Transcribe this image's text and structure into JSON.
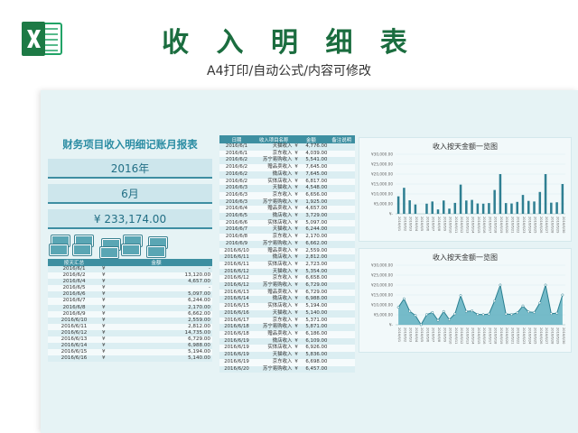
{
  "header": {
    "title": "收 入 明 细 表",
    "subtitle": "A4打印/自动公式/内容可修改"
  },
  "colors": {
    "accent": "#3d8fa1",
    "title_green": "#1b6d3f",
    "sheet_bg": "#e6f3f5"
  },
  "icons": {
    "logo": "excel-logo-icon",
    "money": "money-stack-icon"
  },
  "summary": {
    "title": "财务项目收入明细记账月报表",
    "year": "2016年",
    "month": "6月",
    "total": "¥ 233,174.00"
  },
  "daily_table": {
    "headers": [
      "按天汇总",
      "金额"
    ],
    "rows": [
      {
        "date": "2016/6/1",
        "currency": "¥",
        "amount": "-"
      },
      {
        "date": "2016/6/2",
        "currency": "¥",
        "amount": "13,120.00"
      },
      {
        "date": "2016/6/4",
        "currency": "¥",
        "amount": "4,657.00"
      },
      {
        "date": "2016/6/5",
        "currency": "¥",
        "amount": "-"
      },
      {
        "date": "2016/6/6",
        "currency": "¥",
        "amount": "5,097.00"
      },
      {
        "date": "2016/6/7",
        "currency": "¥",
        "amount": "6,244.00"
      },
      {
        "date": "2016/6/8",
        "currency": "¥",
        "amount": "2,170.00"
      },
      {
        "date": "2016/6/9",
        "currency": "¥",
        "amount": "6,662.00"
      },
      {
        "date": "2016/6/10",
        "currency": "¥",
        "amount": "2,559.00"
      },
      {
        "date": "2016/6/11",
        "currency": "¥",
        "amount": "2,812.00"
      },
      {
        "date": "2016/6/12",
        "currency": "¥",
        "amount": "14,735.00"
      },
      {
        "date": "2016/6/13",
        "currency": "¥",
        "amount": "6,729.00"
      },
      {
        "date": "2016/6/14",
        "currency": "¥",
        "amount": "6,988.00"
      },
      {
        "date": "2016/6/15",
        "currency": "¥",
        "amount": "5,194.00"
      },
      {
        "date": "2016/6/16",
        "currency": "¥",
        "amount": "5,140.00"
      }
    ]
  },
  "detail_table": {
    "headers": [
      "日期",
      "收入项目名称",
      "金额",
      "备注说明"
    ],
    "rows": [
      {
        "date": "2016/6/1",
        "type": "天猫收入",
        "currency": "¥",
        "amount": "4,776.00"
      },
      {
        "date": "2016/6/1",
        "type": "京东收入",
        "currency": "¥",
        "amount": "4,039.00"
      },
      {
        "date": "2016/6/2",
        "type": "苏宁易购收入",
        "currency": "¥",
        "amount": "5,541.00"
      },
      {
        "date": "2016/6/2",
        "type": "赠品卖收入",
        "currency": "¥",
        "amount": "7,645.00"
      },
      {
        "date": "2016/6/2",
        "type": "微店收入",
        "currency": "¥",
        "amount": "7,645.00"
      },
      {
        "date": "2016/6/2",
        "type": "实体店收入",
        "currency": "¥",
        "amount": "6,817.00"
      },
      {
        "date": "2016/6/3",
        "type": "天猫收入",
        "currency": "¥",
        "amount": "4,548.00"
      },
      {
        "date": "2016/6/3",
        "type": "京东收入",
        "currency": "¥",
        "amount": "6,656.00"
      },
      {
        "date": "2016/6/3",
        "type": "苏宁易购收入",
        "currency": "¥",
        "amount": "1,925.00"
      },
      {
        "date": "2016/6/4",
        "type": "赠品卖收入",
        "currency": "¥",
        "amount": "4,657.00"
      },
      {
        "date": "2016/6/5",
        "type": "微店收入",
        "currency": "¥",
        "amount": "3,729.00"
      },
      {
        "date": "2016/6/6",
        "type": "实体店收入",
        "currency": "¥",
        "amount": "5,097.00"
      },
      {
        "date": "2016/6/7",
        "type": "天猫收入",
        "currency": "¥",
        "amount": "6,244.00"
      },
      {
        "date": "2016/6/8",
        "type": "京东收入",
        "currency": "¥",
        "amount": "2,170.00"
      },
      {
        "date": "2016/6/9",
        "type": "苏宁易购收入",
        "currency": "¥",
        "amount": "6,662.00"
      },
      {
        "date": "2016/6/10",
        "type": "赠品卖收入",
        "currency": "¥",
        "amount": "2,559.00"
      },
      {
        "date": "2016/6/11",
        "type": "微店收入",
        "currency": "¥",
        "amount": "2,812.00"
      },
      {
        "date": "2016/6/11",
        "type": "实体店收入",
        "currency": "¥",
        "amount": "2,723.00"
      },
      {
        "date": "2016/6/12",
        "type": "天猫收入",
        "currency": "¥",
        "amount": "5,354.00"
      },
      {
        "date": "2016/6/12",
        "type": "京东收入",
        "currency": "¥",
        "amount": "6,658.00"
      },
      {
        "date": "2016/6/12",
        "type": "苏宁易购收入",
        "currency": "¥",
        "amount": "6,729.00"
      },
      {
        "date": "2016/6/13",
        "type": "赠品卖收入",
        "currency": "¥",
        "amount": "6,729.00"
      },
      {
        "date": "2016/6/14",
        "type": "微店收入",
        "currency": "¥",
        "amount": "6,988.00"
      },
      {
        "date": "2016/6/15",
        "type": "实体店收入",
        "currency": "¥",
        "amount": "5,194.00"
      },
      {
        "date": "2016/6/16",
        "type": "天猫收入",
        "currency": "¥",
        "amount": "5,140.00"
      },
      {
        "date": "2016/6/17",
        "type": "京东收入",
        "currency": "¥",
        "amount": "5,371.00"
      },
      {
        "date": "2016/6/18",
        "type": "苏宁易购收入",
        "currency": "¥",
        "amount": "5,871.00"
      },
      {
        "date": "2016/6/18",
        "type": "赠品卖收入",
        "currency": "¥",
        "amount": "6,186.00"
      },
      {
        "date": "2016/6/19",
        "type": "微店收入",
        "currency": "¥",
        "amount": "6,109.00"
      },
      {
        "date": "2016/6/19",
        "type": "实体店收入",
        "currency": "¥",
        "amount": "6,926.00"
      },
      {
        "date": "2016/6/19",
        "type": "天猫收入",
        "currency": "¥",
        "amount": "5,836.00"
      },
      {
        "date": "2016/6/19",
        "type": "京东收入",
        "currency": "¥",
        "amount": "6,698.00"
      },
      {
        "date": "2016/6/20",
        "type": "苏宁易购收入",
        "currency": "¥",
        "amount": "6,457.00"
      }
    ]
  },
  "chart_data": [
    {
      "type": "bar",
      "title": "收入按天金额一览图",
      "ylim": [
        0,
        30000
      ],
      "yticks": [
        "¥-",
        "¥5,000.00",
        "¥10,000.00",
        "¥15,000.00",
        "¥20,000.00",
        "¥25,000.00",
        "¥30,000.00"
      ],
      "categories": [
        "2016/6/1",
        "2016/6/2",
        "2016/6/3",
        "2016/6/4",
        "2016/6/5",
        "2016/6/6",
        "2016/6/7",
        "2016/6/8",
        "2016/6/9",
        "2016/6/10",
        "2016/6/11",
        "2016/6/12",
        "2016/6/13",
        "2016/6/14",
        "2016/6/15",
        "2016/6/16",
        "2016/6/17",
        "2016/6/18",
        "2016/6/19",
        "2016/6/20",
        "2016/6/21",
        "2016/6/22",
        "2016/6/23",
        "2016/6/24",
        "2016/6/25",
        "2016/6/26",
        "2016/6/27",
        "2016/6/28",
        "2016/6/29",
        "2016/6/30"
      ],
      "values": [
        8800,
        13100,
        6800,
        4700,
        0,
        5100,
        6200,
        2200,
        6700,
        2600,
        5500,
        14700,
        6700,
        7000,
        5200,
        5100,
        5400,
        12000,
        20000,
        5400,
        5200,
        6000,
        9500,
        6500,
        6200,
        11000,
        20000,
        5600,
        5800,
        15000
      ]
    },
    {
      "type": "area",
      "title": "收入按天金额一览图",
      "ylim": [
        0,
        30000
      ],
      "yticks": [
        "¥-",
        "¥5,000.00",
        "¥10,000.00",
        "¥15,000.00",
        "¥20,000.00",
        "¥25,000.00",
        "¥30,000.00"
      ],
      "categories": [
        "2016/6/1",
        "2016/6/2",
        "2016/6/3",
        "2016/6/4",
        "2016/6/5",
        "2016/6/6",
        "2016/6/7",
        "2016/6/8",
        "2016/6/9",
        "2016/6/10",
        "2016/6/11",
        "2016/6/12",
        "2016/6/13",
        "2016/6/14",
        "2016/6/15",
        "2016/6/16",
        "2016/6/17",
        "2016/6/18",
        "2016/6/19",
        "2016/6/20",
        "2016/6/21",
        "2016/6/22",
        "2016/6/23",
        "2016/6/24",
        "2016/6/25",
        "2016/6/26",
        "2016/6/27",
        "2016/6/28",
        "2016/6/29",
        "2016/6/30"
      ],
      "values": [
        8800,
        13100,
        6800,
        4700,
        0,
        5100,
        6200,
        2200,
        6700,
        2600,
        5500,
        14700,
        6700,
        7000,
        5200,
        5100,
        5400,
        12000,
        20000,
        5400,
        5200,
        6000,
        9500,
        6500,
        6200,
        11000,
        20000,
        5600,
        5800,
        15000
      ]
    }
  ]
}
